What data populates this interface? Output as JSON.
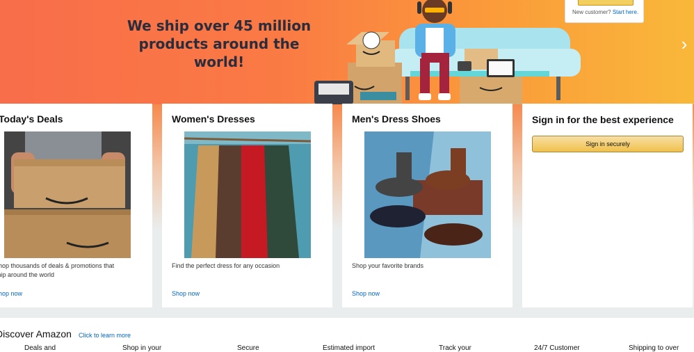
{
  "hero": {
    "title_line1": "We ship over 45 million",
    "title_line2": "products around the world!",
    "next_glyph": "›"
  },
  "signin_popover": {
    "new_customer": "New customer?",
    "start_here": "Start here."
  },
  "cards": [
    {
      "title": "Today's Deals",
      "desc": "Shop thousands of deals & promotions that ship around the world",
      "link": "Shop now"
    },
    {
      "title": "Women's Dresses",
      "desc": "Find the perfect dress for any occasion",
      "link": "Shop now"
    },
    {
      "title": "Men's Dress Shoes",
      "desc": "Shop your favorite brands",
      "link": "Shop now"
    }
  ],
  "signin_card": {
    "title": "Sign in for the best experience",
    "button": "Sign in securely"
  },
  "discover": {
    "title": "Discover Amazon",
    "link": "Click to learn more",
    "items": [
      "Deals and",
      "Shop in your",
      "Secure",
      "Estimated import",
      "Track your",
      "24/7 Customer",
      "Shipping to over"
    ]
  },
  "colors": {
    "hero_left": "#f86d4a",
    "hero_right": "#f9b83a",
    "link": "#0066c0",
    "button": "#f0c14b"
  }
}
